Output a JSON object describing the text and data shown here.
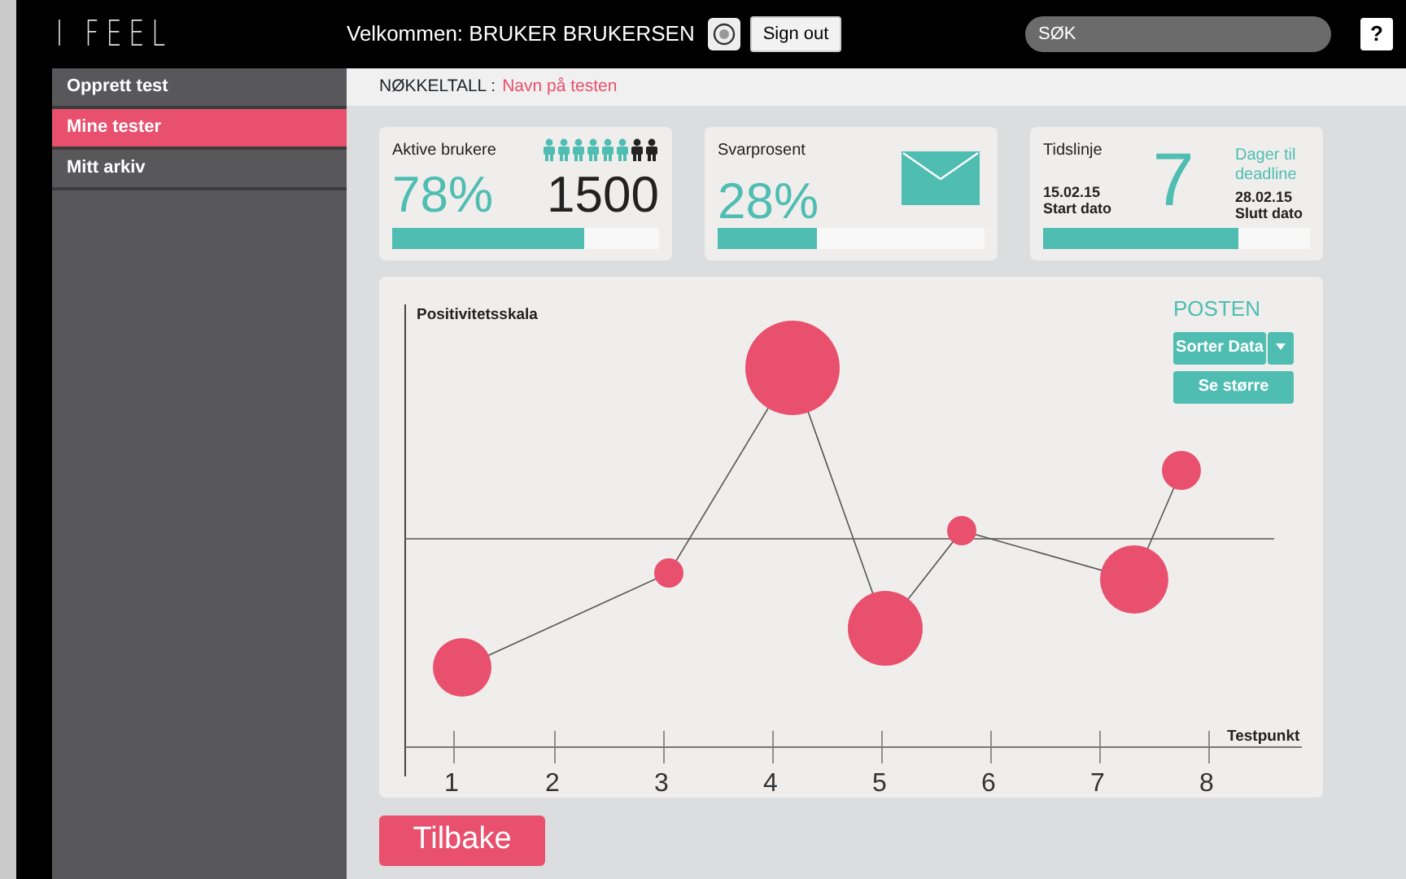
{
  "header": {
    "logo": "I FEEL",
    "welcome": "Velkommen: BRUKER BRUKERSEN",
    "sign_out": "Sign out",
    "search": {
      "placeholder": "SØK"
    },
    "help": "?"
  },
  "sidebar": {
    "items": [
      {
        "label": "Opprett test",
        "selected": false
      },
      {
        "label": "Mine tester",
        "selected": true
      },
      {
        "label": "Mitt arkiv",
        "selected": false
      }
    ]
  },
  "breadcrumb": {
    "label": "NØKKELTALL :",
    "test_name": "Navn på testen"
  },
  "cards": [
    {
      "kind": "users",
      "title": "Aktive brukere",
      "value": "78%",
      "count": "1500",
      "people": [
        {
          "active": true
        },
        {
          "active": true
        },
        {
          "active": true
        },
        {
          "active": true
        },
        {
          "active": true
        },
        {
          "active": true
        },
        {
          "active": false
        },
        {
          "active": false
        }
      ],
      "level": 0.72
    },
    {
      "kind": "response",
      "title": "Svarprosent",
      "value": "28%",
      "level": 0.37
    },
    {
      "kind": "timeline",
      "title": "Tidslinje",
      "days": "7",
      "days_label": "Dager til deadline",
      "start_date": "15.02.15",
      "start_label": "Start dato",
      "end_date": "28.02.15",
      "end_label": "Slutt dato",
      "level": 0.73
    }
  ],
  "chart": {
    "ylabel": "Positivitetsskala",
    "xlabel": "Testpunkt",
    "x_labels": [
      "1",
      "2",
      "3",
      "4",
      "5",
      "6",
      "7",
      "8"
    ],
    "panel": {
      "title": "POSTEN",
      "sort_button": "Sorter Data",
      "expand_button": "Se større"
    }
  },
  "back_button": "Tilbake"
}
